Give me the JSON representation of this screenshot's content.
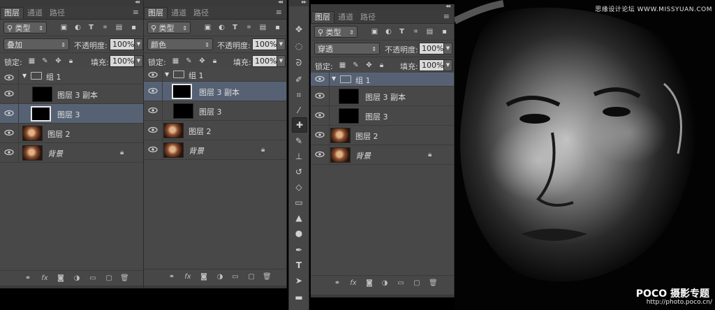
{
  "watermark_top": "思缘设计论坛 WWW.MISSYUAN.COM",
  "watermark_logo": "POCO 摄影专题",
  "watermark_url": "http://photo.poco.cn/",
  "panels": [
    {
      "tabs": [
        "图层",
        "通道",
        "路径"
      ],
      "filter_label": "类型",
      "blend_mode": "叠加",
      "opacity_label": "不透明度:",
      "opacity_value": "100%",
      "lock_label": "锁定:",
      "fill_label": "填充:",
      "fill_value": "100%",
      "layers": [
        {
          "name": "组 1"
        },
        {
          "name": "图层 3 副本"
        },
        {
          "name": "图层 3"
        },
        {
          "name": "图层 2"
        },
        {
          "name": "背景"
        }
      ]
    },
    {
      "tabs": [
        "图层",
        "通道",
        "路径"
      ],
      "filter_label": "类型",
      "blend_mode": "颜色",
      "opacity_label": "不透明度:",
      "opacity_value": "100%",
      "lock_label": "锁定:",
      "fill_label": "填充:",
      "fill_value": "100%",
      "layers": [
        {
          "name": "组 1"
        },
        {
          "name": "图层 3 副本"
        },
        {
          "name": "图层 3"
        },
        {
          "name": "图层 2"
        },
        {
          "name": "背景"
        }
      ]
    },
    {
      "tabs": [
        "图层",
        "通道",
        "路径"
      ],
      "filter_label": "类型",
      "blend_mode": "穿透",
      "opacity_label": "不透明度:",
      "opacity_value": "100%",
      "lock_label": "锁定:",
      "fill_label": "填充:",
      "fill_value": "100%",
      "layers": [
        {
          "name": "组 1"
        },
        {
          "name": "图层 3 副本"
        },
        {
          "name": "图层 3"
        },
        {
          "name": "图层 2"
        },
        {
          "name": "背景"
        }
      ]
    }
  ],
  "tools": [
    "move-icon",
    "marquee-icon",
    "lasso-icon",
    "quick-select-icon",
    "crop-icon",
    "eyedropper-icon",
    "healing-brush-icon",
    "brush-icon",
    "clone-stamp-icon",
    "history-brush-icon",
    "eraser-icon",
    "gradient-icon",
    "blur-icon",
    "dodge-icon",
    "pen-icon",
    "type-icon",
    "path-select-icon",
    "shape-icon"
  ],
  "colors": {
    "panel_bg": "#474747",
    "selected_row": "#566274",
    "background": "#000000"
  }
}
